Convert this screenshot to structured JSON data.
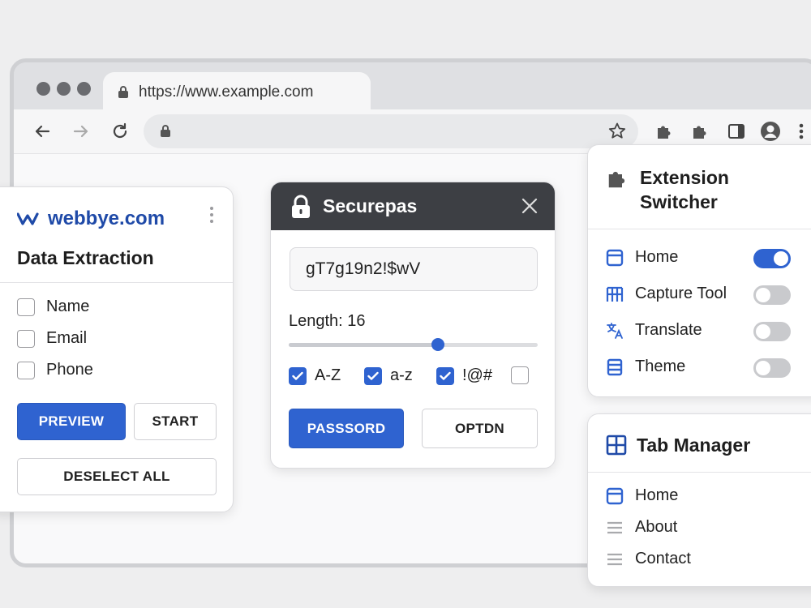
{
  "browser": {
    "url": "https://www.example.com"
  },
  "left_panel": {
    "brand": "webbye.com",
    "title": "Data Extraction",
    "fields": [
      {
        "label": "Name",
        "checked": false
      },
      {
        "label": "Email",
        "checked": false
      },
      {
        "label": "Phone",
        "checked": false
      }
    ],
    "preview_label": "PREVIEW",
    "start_label": "START",
    "deselect_label": "DESELECT ALL"
  },
  "password_panel": {
    "title": "Securepas",
    "password": "gT7g19n2!$wV",
    "length_label": "Length: 16",
    "slider_fraction": 0.6,
    "options": [
      {
        "label": "A-Z",
        "checked": true
      },
      {
        "label": "a-z",
        "checked": true
      },
      {
        "label": "!@#",
        "checked": true
      },
      {
        "label": "",
        "checked": false
      }
    ],
    "primary_label": "PASSSORD",
    "secondary_label": "OPTDN"
  },
  "extension_switcher": {
    "title_line1": "Extension",
    "title_line2": "Switcher",
    "items": [
      {
        "label": "Home",
        "icon": "window-icon",
        "enabled": true
      },
      {
        "label": "Capture Tool",
        "icon": "capture-icon",
        "enabled": false
      },
      {
        "label": "Translate",
        "icon": "translate-icon",
        "enabled": false
      },
      {
        "label": "Theme",
        "icon": "theme-icon",
        "enabled": false
      }
    ]
  },
  "tab_manager": {
    "title": "Tab Manager",
    "items": [
      {
        "label": "Home",
        "icon": "window-icon"
      },
      {
        "label": "About",
        "icon": "lines-icon"
      },
      {
        "label": "Contact",
        "icon": "lines-icon"
      }
    ]
  },
  "colors": {
    "accent": "#2f63d0",
    "brand": "#1f4aa8",
    "header_dark": "#3d3f44"
  }
}
